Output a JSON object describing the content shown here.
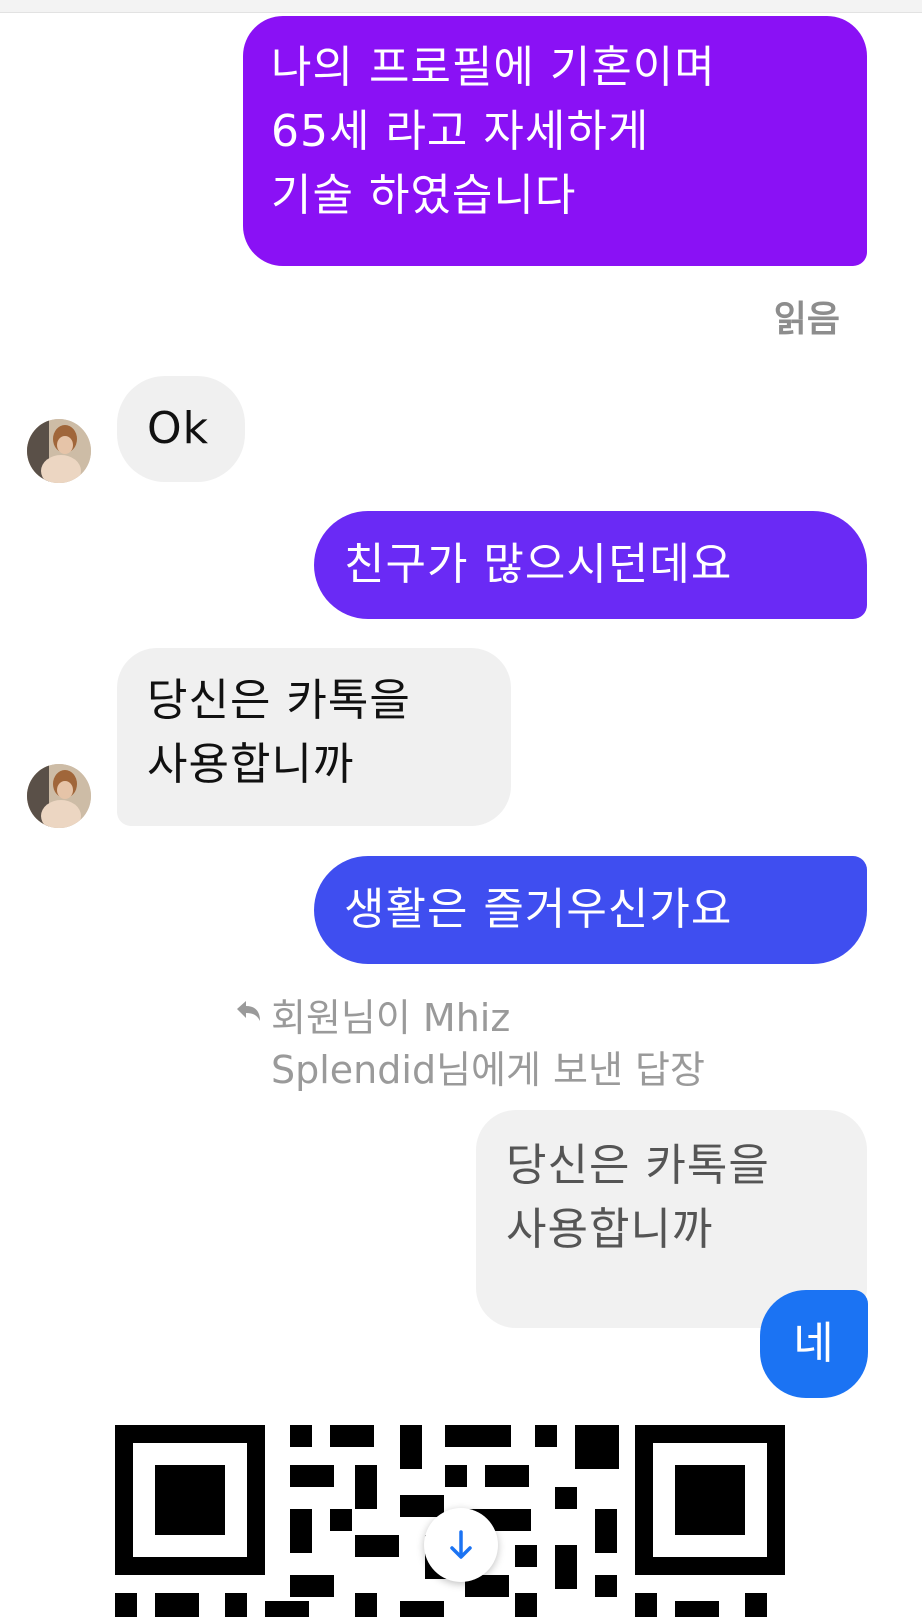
{
  "messages": {
    "m1": "나의 프로필에 기혼이며\n65세 라고 자세하게\n기술 하였습니다",
    "read_receipt": "읽음",
    "m2": "Ok",
    "m3": "친구가 많으시던데요",
    "m4": "당신은 카톡을\n사용합니까",
    "m5": "생활은 즐거우신가요",
    "reply_context": "회원님이 Mhiz\nSplendid님에게 보낸 답장",
    "quoted": "당신은 카톡을\n사용합니까",
    "m6": "네"
  },
  "colors": {
    "purple": "#8a11f5",
    "violet": "#6a2af5",
    "indigo": "#3f4ef0",
    "blue": "#1b73f3",
    "incoming": "#f0f0f0"
  },
  "icons": {
    "reply": "reply-arrow-icon",
    "scroll": "arrow-down-icon"
  }
}
